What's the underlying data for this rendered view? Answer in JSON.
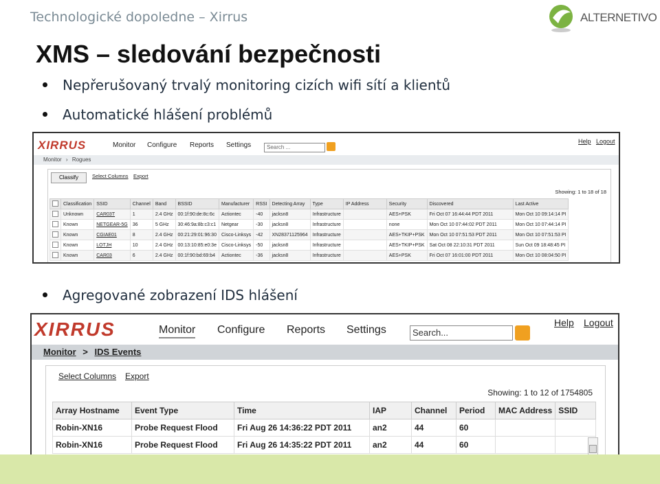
{
  "header": {
    "title": "Technologické dopoledne – Xirrus",
    "logo_text": "ALTERNETIVO"
  },
  "slide": {
    "title": "XMS – sledování bezpečnosti",
    "bullets": [
      "Nepřerušovaný trvalý monitoring cizích wifi sítí a klientů",
      "Automatické hlášení problémů",
      "Agregované zobrazení IDS hlášení"
    ]
  },
  "screenshot1": {
    "brand": "XIRRUS",
    "nav": [
      "Monitor",
      "Configure",
      "Reports",
      "Settings"
    ],
    "search_placeholder": "Search ...",
    "links": [
      "Help",
      "Logout"
    ],
    "breadcrumb": [
      "Monitor",
      "Rogues"
    ],
    "classify_button": "Classify",
    "toolbar": [
      "Select Columns",
      "Export"
    ],
    "showing": "Showing: 1 to 18 of 18",
    "columns": [
      "Classification",
      "SSID",
      "Channel",
      "Band",
      "BSSID",
      "Manufacturer",
      "RSSI",
      "Detecting Array",
      "Type",
      "IP Address",
      "Security",
      "Discovered",
      "Last Active"
    ],
    "rows": [
      [
        "Unknown",
        "CAR03T",
        "1",
        "2.4 GHz",
        "00:1f:90:de:8c:6c",
        "Actiontec",
        "-40",
        "jacksn8",
        "Infrastructure",
        "",
        "AES+PSK",
        "Fri Oct 07 16:44:44 PDT 2011",
        "Mon Oct 10 09:14:14 PI"
      ],
      [
        "Known",
        "NETGEAR-5G",
        "36",
        "5 GHz",
        "30:46:9a:8b:c3:c1",
        "Netgear",
        "-30",
        "jacksn8",
        "Infrastructure",
        "",
        "none",
        "Mon Oct 10 07:44:02 PDT 2011",
        "Mon Oct 10 07:44:14 PI"
      ],
      [
        "Known",
        "CGIAE01",
        "8",
        "2.4 GHz",
        "00:21:29:01:96:30",
        "Cisco-Linksys",
        "-42",
        "XN28371125964",
        "Infrastructure",
        "",
        "AES+TKIP+PSK",
        "Mon Oct 10 07:51:53 PDT 2011",
        "Mon Oct 10 07:51:53 PI"
      ],
      [
        "Known",
        "LOTJH",
        "10",
        "2.4 GHz",
        "00:13:10:85:e0:3e",
        "Cisco-Linksys",
        "-50",
        "jacksn8",
        "Infrastructure",
        "",
        "AES+TKIP+PSK",
        "Sat Oct 08 22:10:31 PDT 2011",
        "Sun Oct 09 18:48:45 PI"
      ],
      [
        "Known",
        "CAR03",
        "6",
        "2.4 GHz",
        "00:1f:90:bd:69:b4",
        "Actiontec",
        "-36",
        "jacksn8",
        "Infrastructure",
        "",
        "AES+PSK",
        "Fri Oct 07 16:01:00 PDT 2011",
        "Mon Oct 10 08:04:50 PI"
      ]
    ]
  },
  "screenshot2": {
    "brand": "XIRRUS",
    "nav": [
      "Monitor",
      "Configure",
      "Reports",
      "Settings"
    ],
    "search_placeholder": "Search...",
    "links": [
      "Help",
      "Logout"
    ],
    "breadcrumb": [
      "Monitor",
      ">",
      "IDS Events"
    ],
    "toolbar": [
      "Select Columns",
      "Export"
    ],
    "showing": "Showing: 1 to 12 of 1754805",
    "columns": [
      "Array Hostname",
      "Event Type",
      "Time",
      "IAP",
      "Channel",
      "Period",
      "MAC Address",
      "SSID"
    ],
    "rows": [
      [
        "Robin-XN16",
        "Probe Request Flood",
        "Fri Aug 26 14:36:22 PDT 2011",
        "an2",
        "44",
        "60",
        "",
        ""
      ],
      [
        "Robin-XN16",
        "Probe Request Flood",
        "Fri Aug 26 14:35:22 PDT 2011",
        "an2",
        "44",
        "60",
        "",
        ""
      ]
    ]
  },
  "colors": {
    "accent_green": "#d9e8a9",
    "brand_red": "#c0392b",
    "search_go": "#f0a020"
  }
}
